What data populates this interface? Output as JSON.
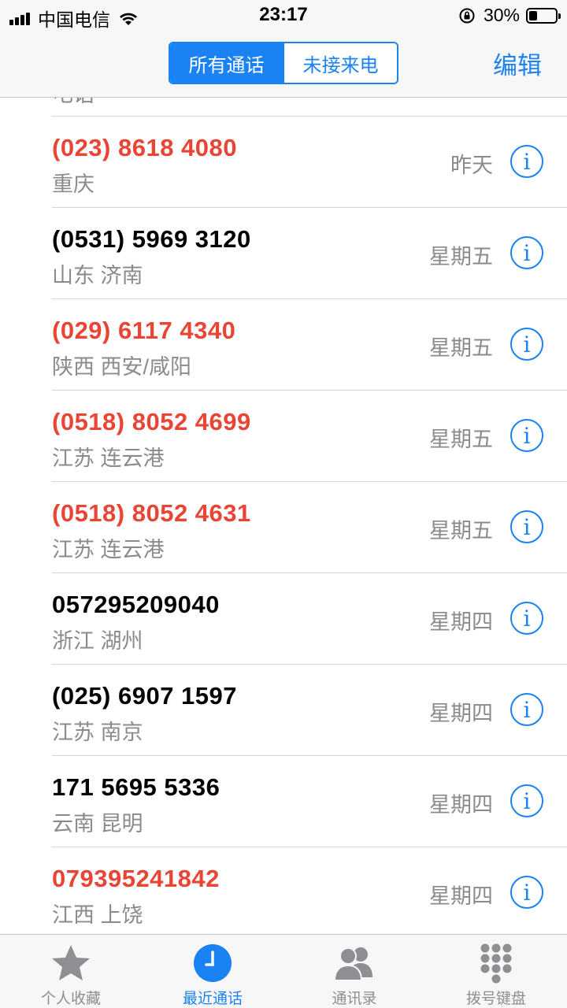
{
  "status_bar": {
    "carrier": "中国电信",
    "time": "23:17",
    "battery_percent": "30%",
    "battery_level": 0.3
  },
  "nav": {
    "segments": [
      {
        "label": "所有通话",
        "active": true
      },
      {
        "label": "未接来电",
        "active": false
      }
    ],
    "edit_label": "编辑"
  },
  "partial_row": {
    "location": "电话"
  },
  "calls": [
    {
      "number": "(023) 8618 4080",
      "location": "重庆",
      "day": "昨天",
      "missed": true
    },
    {
      "number": "(0531) 5969 3120",
      "location": "山东 济南",
      "day": "星期五",
      "missed": false
    },
    {
      "number": "(029) 6117 4340",
      "location": "陕西 西安/咸阳",
      "day": "星期五",
      "missed": true
    },
    {
      "number": "(0518) 8052 4699",
      "location": "江苏 连云港",
      "day": "星期五",
      "missed": true
    },
    {
      "number": "(0518) 8052 4631",
      "location": "江苏 连云港",
      "day": "星期五",
      "missed": true
    },
    {
      "number": "057295209040",
      "location": "浙江 湖州",
      "day": "星期四",
      "missed": false
    },
    {
      "number": "(025) 6907 1597",
      "location": "江苏 南京",
      "day": "星期四",
      "missed": false
    },
    {
      "number": "171 5695 5336",
      "location": "云南 昆明",
      "day": "星期四",
      "missed": false
    },
    {
      "number": "079395241842",
      "location": "江西 上饶",
      "day": "星期四",
      "missed": true
    }
  ],
  "info_glyph": "i",
  "tabs": [
    {
      "label": "个人收藏",
      "icon": "star-icon",
      "active": false
    },
    {
      "label": "最近通话",
      "icon": "clock-icon",
      "active": true
    },
    {
      "label": "通讯录",
      "icon": "contacts-icon",
      "active": false
    },
    {
      "label": "拨号键盘",
      "icon": "keypad-icon",
      "active": false
    }
  ],
  "colors": {
    "accent": "#1a82f3",
    "missed": "#ea4434",
    "secondary_text": "#8a8a8f",
    "tab_inactive": "#8e8e93"
  }
}
